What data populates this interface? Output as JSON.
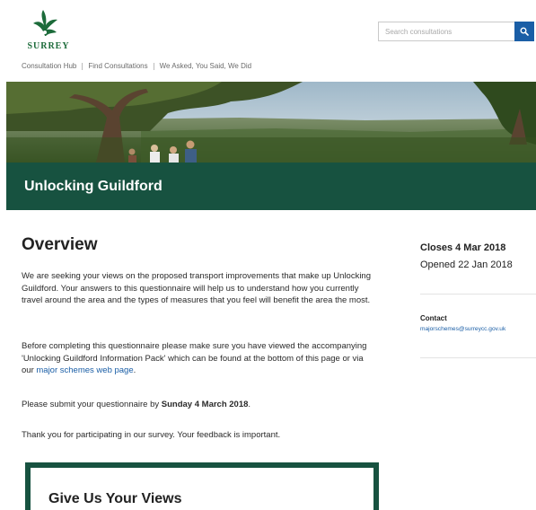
{
  "header": {
    "logo_text": "SURREY",
    "search": {
      "placeholder": "Search consultations"
    }
  },
  "nav": {
    "items": [
      "Consultation Hub",
      "Find Consultations",
      "We Asked, You Said, We Did"
    ]
  },
  "page": {
    "title": "Unlocking Guildford"
  },
  "overview": {
    "heading": "Overview",
    "p1": "We are seeking your views on the proposed transport improvements that make up Unlocking Guildford. Your answers to this questionnaire will help us to understand how you currently travel around the area and the types of measures that you feel will benefit the area the most.",
    "p2_before": "Before completing this questionnaire please make sure you have viewed the accompanying 'Unlocking Guildford Information Pack' which can be found at the bottom of this page or via our ",
    "p2_link": "major schemes web page",
    "p2_after": ".",
    "p3_before": "Please submit your questionnaire by ",
    "p3_strong": "Sunday 4 March 2018",
    "p3_after": ".",
    "p4": "Thank you for participating in our survey. Your feedback is important."
  },
  "sidebar": {
    "closes": "Closes 4 Mar 2018",
    "opened": "Opened 22 Jan 2018",
    "contact_label": "Contact",
    "contact_email": "majorschemes@surreycc.gov.uk"
  },
  "views_box": {
    "title": "Give Us Your Views"
  },
  "colors": {
    "brand_green": "#175240",
    "logo_green": "#1c6b3a",
    "link_blue": "#1a5ea6"
  }
}
